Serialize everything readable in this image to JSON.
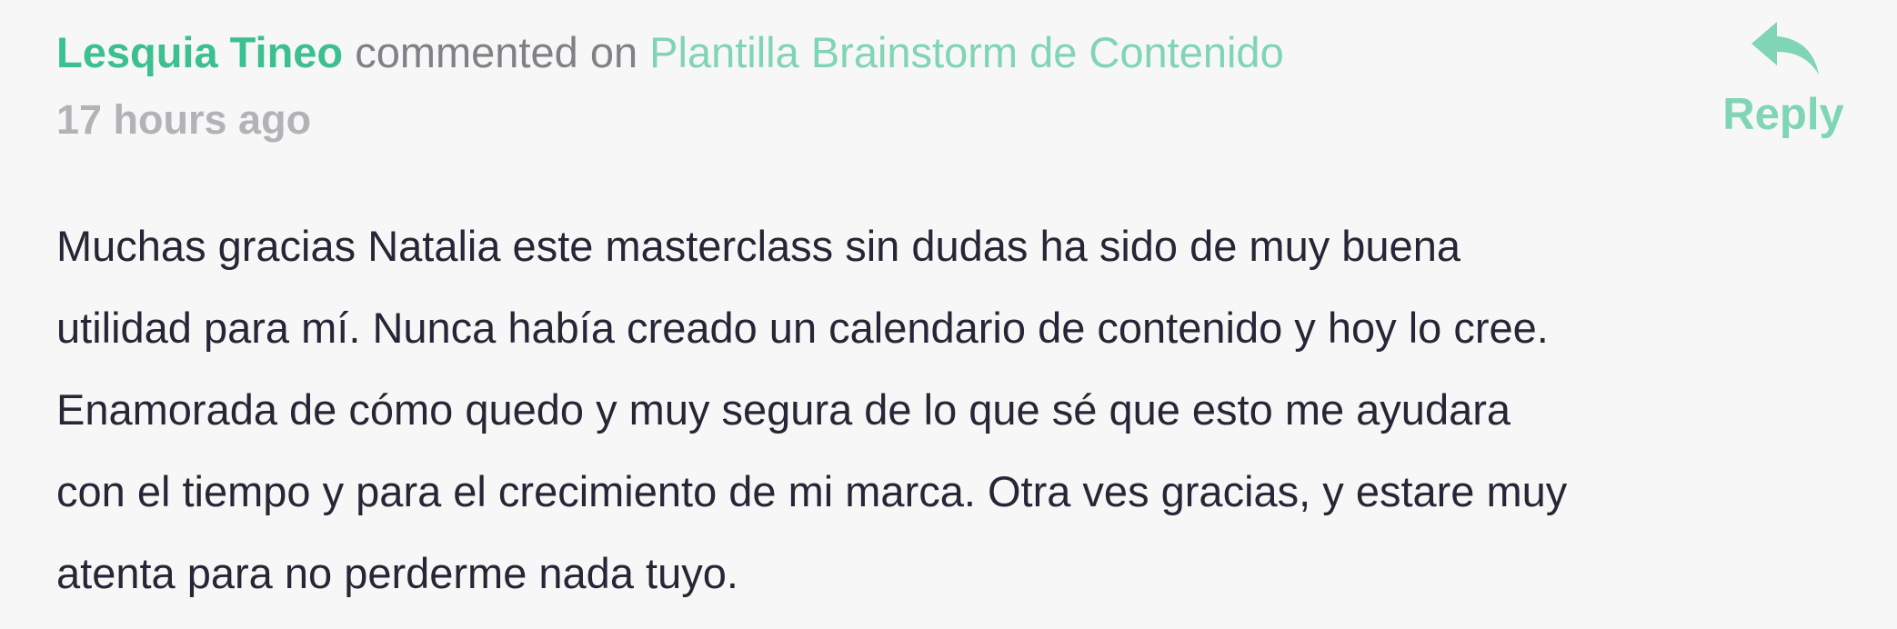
{
  "comment": {
    "author": "Lesquia Tineo",
    "action": "commented on",
    "target": "Plantilla Brainstorm de Contenido",
    "timestamp": "17 hours ago",
    "reply_label": "Reply",
    "reply_icon": "reply-arrow-icon",
    "body": "Muchas gracias Natalia este masterclass sin dudas ha sido de muy buena\nutilidad para mí. Nunca había creado un calendario de contenido y hoy lo cree.\nEnamorada de cómo quedo y muy segura de lo que sé que esto me ayudara\ncon el tiempo y para el crecimiento de mi marca. Otra ves gracias, y estare muy\natenta para no perderme nada tuyo."
  },
  "colors": {
    "accent": "#3cc08f",
    "accent_light": "#7fd5b4",
    "muted_text": "#808086",
    "timestamp": "#b3b3b7",
    "body_text": "#262636",
    "background": "#f7f7f7"
  }
}
